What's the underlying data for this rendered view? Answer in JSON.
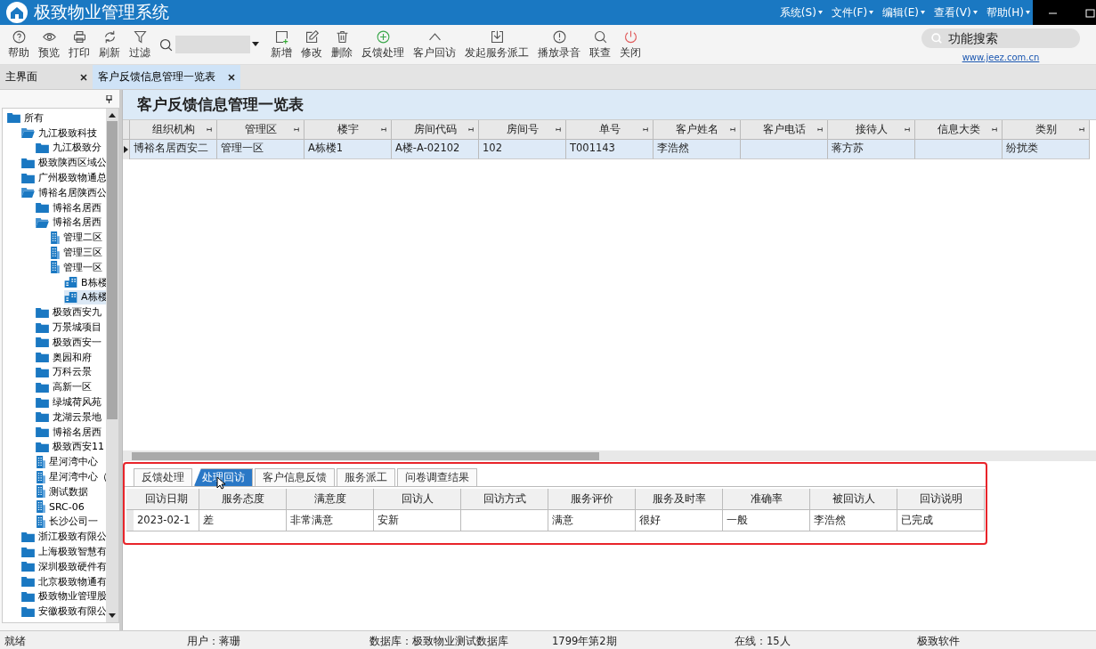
{
  "window": {
    "title": "极致物业管理系统"
  },
  "menu": [
    {
      "label": "系统(S)"
    },
    {
      "label": "文件(F)"
    },
    {
      "label": "编辑(E)"
    },
    {
      "label": "查看(V)"
    },
    {
      "label": "帮助(H)"
    }
  ],
  "toolbar": [
    {
      "kind": "help",
      "label": "帮助"
    },
    {
      "kind": "preview",
      "label": "预览"
    },
    {
      "kind": "print",
      "label": "打印"
    },
    {
      "kind": "refresh",
      "label": "刷新"
    },
    {
      "kind": "filter",
      "label": "过滤"
    },
    {
      "kind": "search"
    },
    {
      "kind": "new",
      "label": "新增"
    },
    {
      "kind": "edit",
      "label": "修改"
    },
    {
      "kind": "delete",
      "label": "删除"
    },
    {
      "kind": "plus",
      "label": "反馈处理"
    },
    {
      "kind": "up",
      "label": "客户回访"
    },
    {
      "kind": "download",
      "label": "发起服务派工"
    },
    {
      "kind": "alert",
      "label": "播放录音"
    },
    {
      "kind": "lookup",
      "label": "联查"
    },
    {
      "kind": "power",
      "label": "关闭"
    }
  ],
  "function_search": {
    "placeholder": "功能搜索",
    "link": "www.jeez.com.cn"
  },
  "tabs": [
    {
      "label": "主界面",
      "selected": false
    },
    {
      "label": "客户反馈信息管理一览表",
      "selected": true
    }
  ],
  "tree": [
    {
      "label": "所有",
      "kind": "folder",
      "selected": false,
      "children": [
        {
          "label": "九江极致科技",
          "kind": "open-folder",
          "selected": false,
          "children": [
            {
              "label": "九江极致分",
              "kind": "folder",
              "selected": false
            }
          ]
        },
        {
          "label": "极致陕西区域公",
          "kind": "folder",
          "selected": false
        },
        {
          "label": "广州极致物通总",
          "kind": "folder",
          "selected": false
        },
        {
          "label": "博裕名居陕西公",
          "kind": "open-folder",
          "selected": false,
          "children": [
            {
              "label": "博裕名居西",
              "kind": "folder",
              "selected": false
            },
            {
              "label": "博裕名居西",
              "kind": "open-folder",
              "selected": false,
              "children": [
                {
                  "label": "管理二区",
                  "kind": "area",
                  "selected": false
                },
                {
                  "label": "管理三区",
                  "kind": "area",
                  "selected": false
                },
                {
                  "label": "管理一区",
                  "kind": "area",
                  "selected": false,
                  "children": [
                    {
                      "label": "B栋楼",
                      "kind": "building",
                      "selected": false
                    },
                    {
                      "label": "A栋楼",
                      "kind": "building",
                      "selected": true
                    }
                  ]
                }
              ]
            },
            {
              "label": "极致西安九",
              "kind": "folder",
              "selected": false
            },
            {
              "label": "万景城项目",
              "kind": "folder",
              "selected": false
            },
            {
              "label": "极致西安一",
              "kind": "folder",
              "selected": false
            },
            {
              "label": "奥园和府",
              "kind": "folder",
              "selected": false
            },
            {
              "label": "万科云景",
              "kind": "folder",
              "selected": false
            },
            {
              "label": "高新一区",
              "kind": "folder",
              "selected": false
            },
            {
              "label": "绿城荷风苑",
              "kind": "folder",
              "selected": false
            },
            {
              "label": "龙湖云景地",
              "kind": "folder",
              "selected": false
            },
            {
              "label": "博裕名居西",
              "kind": "folder",
              "selected": false
            },
            {
              "label": "极致西安11",
              "kind": "folder",
              "selected": false
            },
            {
              "label": "星河湾中心",
              "kind": "area",
              "selected": false
            },
            {
              "label": "星河湾中心（",
              "kind": "area",
              "selected": false
            },
            {
              "label": "测试数据",
              "kind": "area",
              "selected": false
            },
            {
              "label": "SRC-06",
              "kind": "area",
              "selected": false
            },
            {
              "label": "长沙公司一",
              "kind": "area",
              "selected": false
            }
          ]
        },
        {
          "label": "浙江极致有限公",
          "kind": "folder",
          "selected": false
        },
        {
          "label": "上海极致智慧有",
          "kind": "folder",
          "selected": false
        },
        {
          "label": "深圳极致硬件有",
          "kind": "folder",
          "selected": false
        },
        {
          "label": "北京极致物通有",
          "kind": "folder",
          "selected": false
        },
        {
          "label": "极致物业管理股",
          "kind": "folder",
          "selected": false
        },
        {
          "label": "安徽极致有限公",
          "kind": "folder",
          "selected": false
        }
      ]
    }
  ],
  "page_title": "客户反馈信息管理一览表",
  "table": {
    "columns": [
      "组织机构",
      "管理区",
      "楼宇",
      "房间代码",
      "房间号",
      "单号",
      "客户姓名",
      "客户电话",
      "接待人",
      "信息大类",
      "类别"
    ],
    "rows": [
      {
        "selected": true,
        "cells": [
          "博裕名居西安二",
          "管理一区",
          "A栋楼1",
          "A楼-A-02102",
          "102",
          "T001143",
          "李浩然",
          "",
          "蒋方苏",
          "",
          "纷扰类"
        ]
      }
    ]
  },
  "detail_tabs": [
    {
      "label": "反馈处理",
      "selected": false
    },
    {
      "label": "处理回访",
      "selected": true
    },
    {
      "label": "客户信息反馈",
      "selected": false
    },
    {
      "label": "服务派工",
      "selected": false
    },
    {
      "label": "问卷调查结果",
      "selected": false
    }
  ],
  "detail_table": {
    "columns": [
      "回访日期",
      "服务态度",
      "满意度",
      "回访人",
      "回访方式",
      "服务评价",
      "服务及时率",
      "准确率",
      "被回访人",
      "回访说明"
    ],
    "rows": [
      {
        "cells": [
          "2023-02-1",
          "差",
          "非常满意",
          "安新",
          "",
          "满意",
          "很好",
          "一般",
          "李浩然",
          "已完成"
        ]
      }
    ]
  },
  "status_bar": [
    "就绪",
    "用户：蒋珊",
    "数据库：极致物业测试数据库",
    "1799年第2期",
    "在线：15人",
    "极致软件"
  ]
}
